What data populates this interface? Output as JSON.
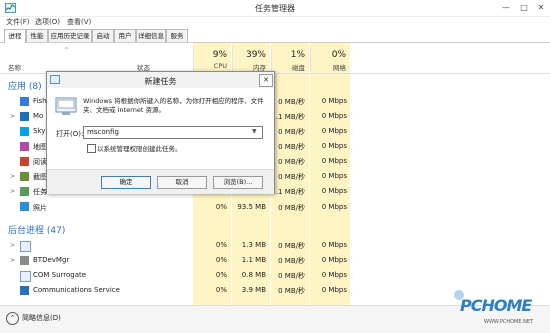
{
  "window": {
    "title": "任务管理器",
    "controls": [
      "—",
      "□",
      "✕"
    ]
  },
  "menu": [
    "文件(F)",
    "选项(O)",
    "查看(V)"
  ],
  "tabs": [
    "进程",
    "性能",
    "应用历史记录",
    "启动",
    "用户",
    "详细信息",
    "服务"
  ],
  "columns": {
    "name": "名称",
    "status": "状态",
    "cpu": {
      "pct": "9%",
      "label": "CPU"
    },
    "mem": {
      "pct": "39%",
      "label": "内存"
    },
    "disk": {
      "pct": "1%",
      "label": "磁盘"
    },
    "net": {
      "pct": "0%",
      "label": "网络"
    }
  },
  "groups": {
    "apps": "应用 (8)",
    "background": "后台进程 (47)"
  },
  "app_rows": [
    {
      "name": "Fish",
      "disk": "0 MB/秒",
      "net": "0 Mbps"
    },
    {
      "name": "Mo",
      "disk": ".1 MB/秒",
      "net": "0 Mbps"
    },
    {
      "name": "Sky",
      "disk": "0 MB/秒",
      "net": "0 Mbps"
    },
    {
      "name": "地图",
      "disk": "0 MB/秒",
      "net": "0 Mbps"
    },
    {
      "name": "阅读",
      "disk": "0 MB/秒",
      "net": "0 Mbps"
    },
    {
      "name": "截图",
      "disk": "0 MB/秒",
      "net": "0 Mbps"
    },
    {
      "name": "任务",
      "disk": ".1 MB/秒",
      "net": "0 Mbps"
    },
    {
      "name": "照片",
      "cpu": "0%",
      "mem": "93.5 MB",
      "disk": "0 MB/秒",
      "net": "0 Mbps"
    }
  ],
  "bg_rows": [
    {
      "name": "",
      "cpu": "0%",
      "mem": "1.3 MB",
      "disk": "0 MB/秒",
      "net": "0 Mbps"
    },
    {
      "name": "BTDevMgr",
      "cpu": "0%",
      "mem": "1.1 MB",
      "disk": "0 MB/秒",
      "net": "0 Mbps"
    },
    {
      "name": "COM Surrogate",
      "cpu": "0%",
      "mem": "0.8 MB",
      "disk": "0 MB/秒",
      "net": "0 Mbps"
    },
    {
      "name": "Communications Service",
      "cpu": "0%",
      "mem": "3.9 MB",
      "disk": "0 MB/秒",
      "net": "0 Mbps"
    }
  ],
  "dialog": {
    "title": "新建任务",
    "close": "✕",
    "desc": "Windows 将根据你所键入的名称，为你打开相应的程序、文件夹、文档或 Internet 资源。",
    "open_label": "打开(O):",
    "input_value": "msconfig",
    "checkbox_label": "以系统管理权限创建此任务。",
    "ok": "确定",
    "cancel": "取消",
    "browse": "浏览(B)..."
  },
  "status": {
    "toggle": "简略信息(D)"
  },
  "watermark": {
    "brand": "PCHOME",
    "url": "WWW.PCHOME.NET"
  }
}
